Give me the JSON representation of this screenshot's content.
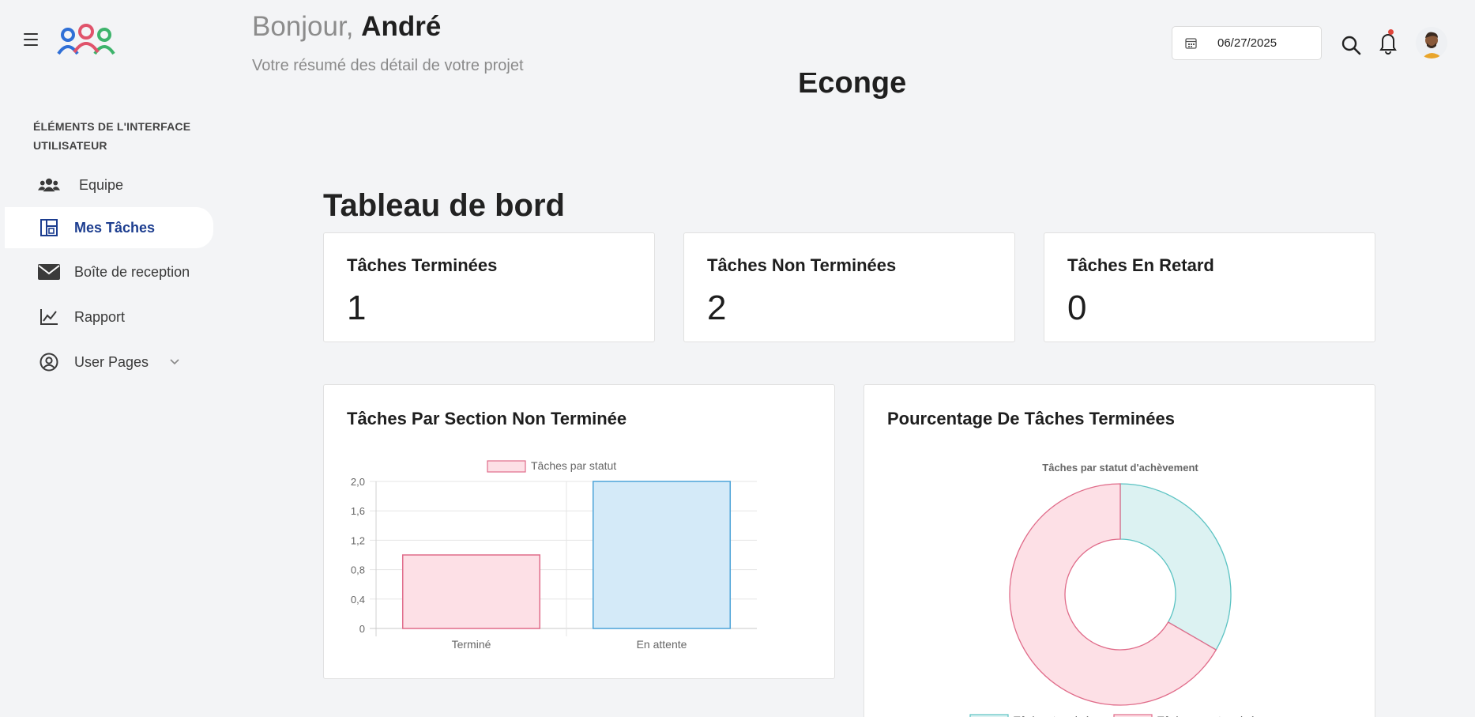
{
  "header": {
    "greeting_prefix": "Bonjour,",
    "user_name": "André",
    "subtitle": "Votre résumé des détail de votre projet",
    "date_value": "06/27/2025"
  },
  "sidebar": {
    "heading": "ÉLÉMENTS DE L'INTERFACE UTILISATEUR",
    "items": [
      {
        "label": "Equipe",
        "icon": "users-icon"
      },
      {
        "label": "Mes Tâches",
        "icon": "tasks-board-icon",
        "active": true
      },
      {
        "label": "Boîte de reception",
        "icon": "envelope-icon"
      },
      {
        "label": "Rapport",
        "icon": "line-chart-icon"
      },
      {
        "label": "User Pages",
        "icon": "user-circle-icon"
      }
    ]
  },
  "main": {
    "app_name": "Econge",
    "page_title": "Tableau de bord",
    "stats": [
      {
        "title": "Tâches Terminées",
        "value": "1"
      },
      {
        "title": "Tâches Non Terminées",
        "value": "2"
      },
      {
        "title": "Tâches En Retard",
        "value": "0"
      }
    ],
    "bar_card_title": "Tâches Par Section Non Terminée",
    "pie_card_title": "Pourcentage De Tâches Terminées"
  },
  "colors": {
    "accent": "#1c3d8f",
    "pink_fill": "#fde0e6",
    "pink_stroke": "#e06c8a",
    "blue_fill": "#d4eaf8",
    "blue_stroke": "#4ca3d8",
    "teal_fill": "#dcf2f2",
    "teal_stroke": "#5cc3c3"
  },
  "chart_data": [
    {
      "type": "bar",
      "legend": [
        "Tâches par statut"
      ],
      "categories": [
        "Terminé",
        "En attente"
      ],
      "series": [
        {
          "name": "Tâches par statut",
          "values": [
            1,
            2
          ]
        }
      ],
      "ylim": [
        0,
        2
      ],
      "yticks": [
        "0",
        "0,4",
        "0,8",
        "1,2",
        "1,6",
        "2,0"
      ],
      "grid": true,
      "legend_position": "top"
    },
    {
      "type": "pie",
      "title": "Tâches par statut d'achèvement",
      "labels": [
        "Tâches terminées",
        "Tâches non terminées"
      ],
      "values": [
        1,
        2
      ],
      "legend_position": "bottom"
    }
  ]
}
